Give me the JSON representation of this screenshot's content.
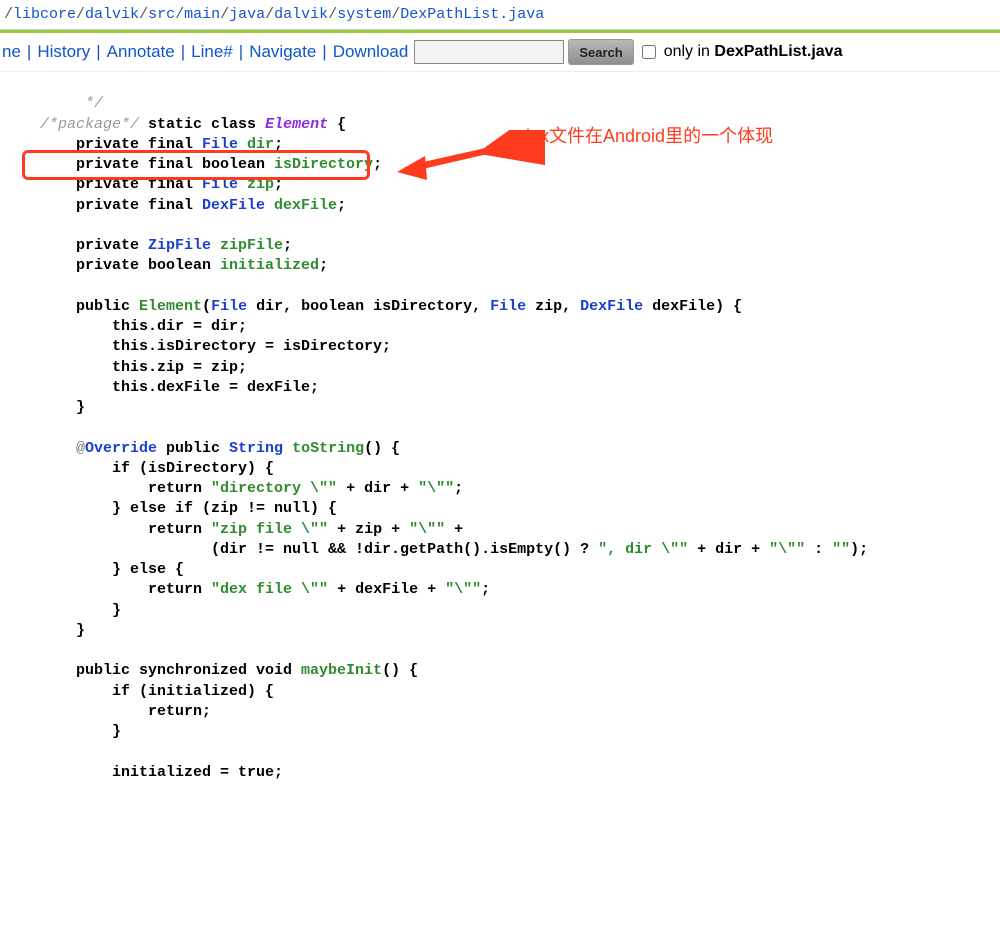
{
  "breadcrumb": {
    "segments": [
      "libcore",
      "dalvik",
      "src",
      "main",
      "java",
      "dalvik",
      "system"
    ],
    "file": "DexPathList.java"
  },
  "toolbar": {
    "items": [
      "ne",
      "History",
      "Annotate",
      "Line#",
      "Navigate",
      "Download"
    ],
    "search_placeholder": "",
    "search_btn": "Search",
    "only_prefix": "only in ",
    "only_target": "DexPathList.java"
  },
  "callout_text": "dex文件在Android里的一个体现",
  "code": {
    "l01": "     */",
    "l02a": "/*package*/",
    "l02b": " static class ",
    "l02c": "Element",
    "l02d": " {",
    "l03a": "    private final ",
    "l03b": "File",
    "l03c": " dir",
    "l03d": ";",
    "l04a": "    private final boolean ",
    "l04b": "isDirectory",
    "l04c": ";",
    "l05a": "    private final ",
    "l05b": "File",
    "l05c": " zip",
    "l05d": ";",
    "l06a": "    private final ",
    "l06b": "DexFile",
    "l06c": " dexFile",
    "l06d": ";",
    "l08a": "    private ",
    "l08b": "ZipFile",
    "l08c": " zipFile",
    "l08d": ";",
    "l09a": "    private boolean ",
    "l09b": "initialized",
    "l09c": ";",
    "l11a": "    public ",
    "l11b": "Element",
    "l11c": "(",
    "l11d": "File",
    "l11e": " dir, boolean isDirectory, ",
    "l11f": "File",
    "l11g": " zip, ",
    "l11h": "DexFile",
    "l11i": " dexFile) {",
    "l12": "        this.dir = dir;",
    "l13": "        this.isDirectory = isDirectory;",
    "l14": "        this.zip = zip;",
    "l15": "        this.dexFile = dexFile;",
    "l16": "    }",
    "l18a": "    @",
    "l18b": "Override",
    "l18c": " public ",
    "l18d": "String",
    "l18e": " toString",
    "l18f": "() {",
    "l19a": "        if (isDirectory) {",
    "l20a": "            return ",
    "l20b": "\"directory \\\"\"",
    "l20c": " + dir + ",
    "l20d": "\"\\\"\"",
    "l20e": ";",
    "l21a": "        } else if (zip != null) {",
    "l22a": "            return ",
    "l22b": "\"zip file \\\"\"",
    "l22c": " + zip + ",
    "l22d": "\"\\\"\"",
    "l22e": " +",
    "l23a": "                   (dir != null && !dir.getPath().isEmpty() ? ",
    "l23b": "\", dir \\\"\"",
    "l23c": " + dir + ",
    "l23d": "\"\\\"\"",
    "l23e": " : ",
    "l23f": "\"\"",
    "l23g": ");",
    "l24": "        } else {",
    "l25a": "            return ",
    "l25b": "\"dex file \\\"\"",
    "l25c": " + dexFile + ",
    "l25d": "\"\\\"\"",
    "l25e": ";",
    "l26": "        }",
    "l27": "    }",
    "l29a": "    public synchronized void ",
    "l29b": "maybeInit",
    "l29c": "() {",
    "l30": "        if (initialized) {",
    "l31": "            return;",
    "l32": "        }",
    "l34": "        initialized = true;"
  }
}
